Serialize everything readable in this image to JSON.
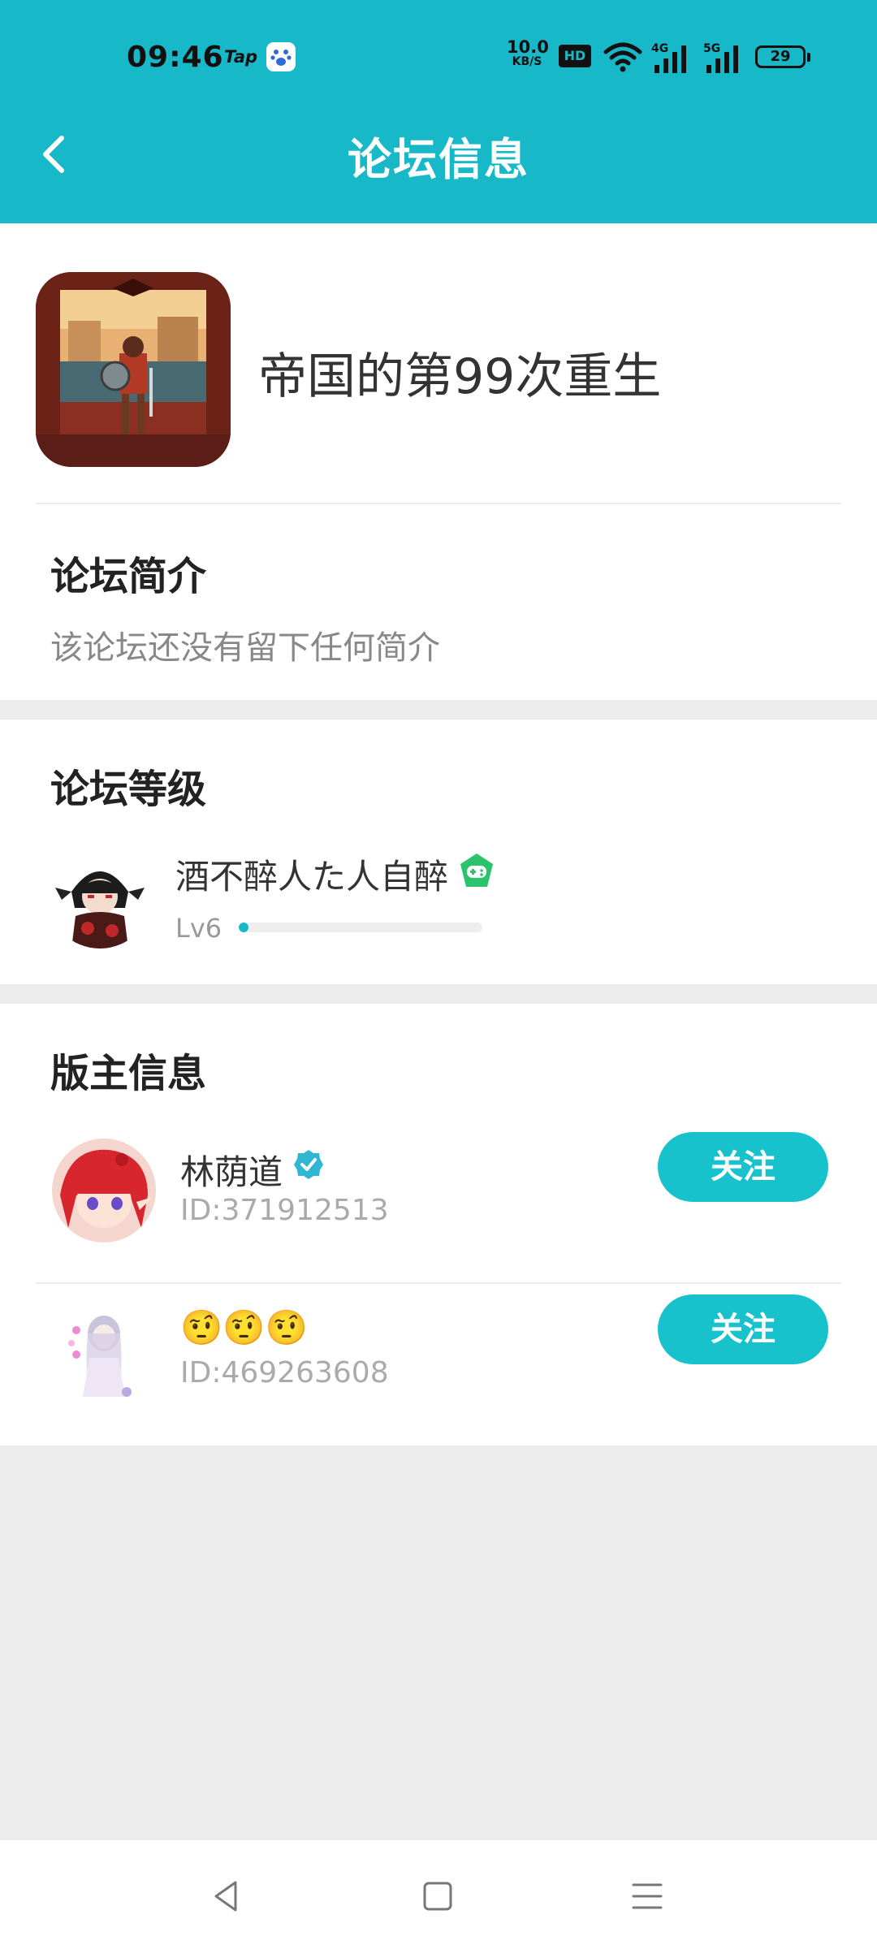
{
  "status_bar": {
    "time": "09:46",
    "tap_label": "Tap",
    "net_speed_value": "10.0",
    "net_speed_unit": "KB/S",
    "hd_label": "HD",
    "signal1_label": "4G",
    "signal2_label": "5G",
    "battery": "29"
  },
  "header": {
    "title": "论坛信息",
    "back_icon": "chevron-left-icon"
  },
  "forum": {
    "name": "帝国的第99次重生",
    "intro_title": "论坛简介",
    "intro_text": "该论坛还没有留下任何简介"
  },
  "level": {
    "section_title": "论坛等级",
    "user_name": "酒不醉人た人自醉",
    "level_label": "Lv6",
    "progress_fraction": 0.04,
    "badge_icon": "game-controller-badge-icon"
  },
  "moderators": {
    "section_title": "版主信息",
    "items": [
      {
        "name": "林荫道",
        "id_text": "ID:371912513",
        "follow_label": "关注",
        "verified": true
      },
      {
        "name": "🤨🤨🤨",
        "id_text": "ID:469263608",
        "follow_label": "关注",
        "verified": false
      }
    ]
  },
  "colors": {
    "accent": "#17b8c8",
    "button": "#17c2cc",
    "background": "#ececec",
    "badge_green": "#2bc46d"
  },
  "sysnav": {
    "back": "triangle-back-icon",
    "home": "square-home-icon",
    "menu": "hamburger-menu-icon"
  }
}
